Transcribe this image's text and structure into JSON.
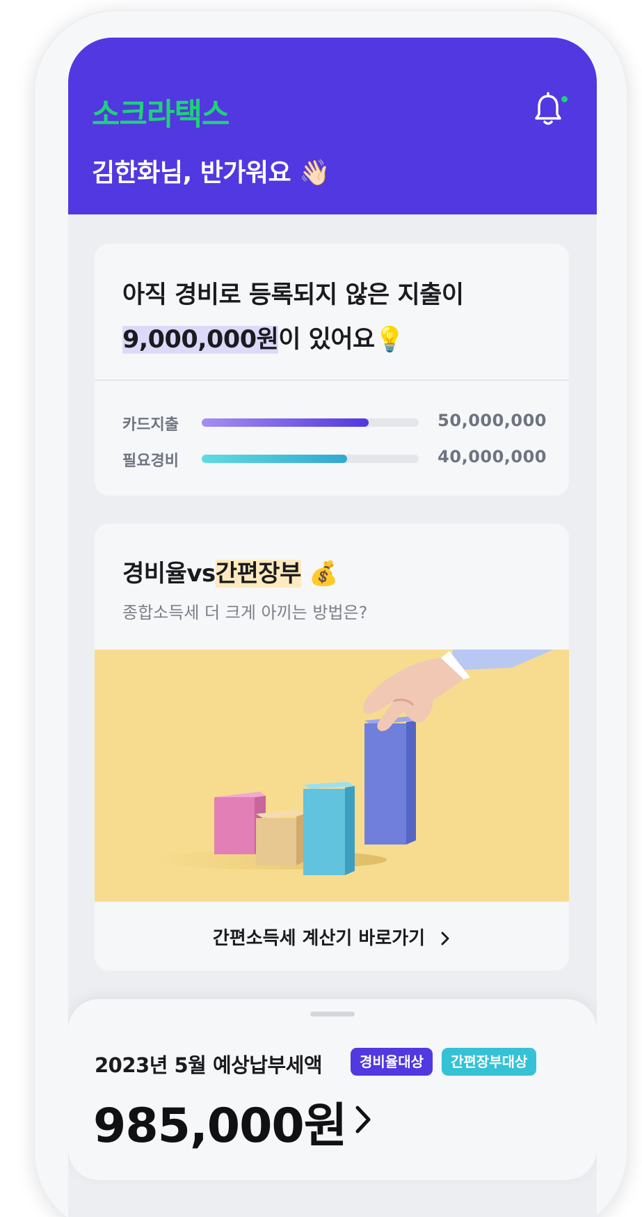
{
  "app": {
    "logo_text": "소크라택스",
    "brand_color": "#5138e0",
    "accent_color": "#1fd17b",
    "notification_icon": "bell-icon"
  },
  "header": {
    "greeting": "김한화님, 반가워요",
    "greeting_emoji": "👋🏻"
  },
  "expense_card": {
    "title_line1": "아직 경비로 등록되지 않은 지출이",
    "highlight_amount": "9,000,000원",
    "title_line2_rest": "이 있어요",
    "title_emoji": "💡",
    "rows": [
      {
        "label": "카드지출",
        "value": "50,000,000",
        "progress": 0.77
      },
      {
        "label": "필요경비",
        "value": "40,000,000",
        "progress": 0.67
      }
    ]
  },
  "promo_card": {
    "title_prefix": "경비율vs",
    "title_highlight": "간편장부",
    "title_emoji": "💰",
    "subtitle": "종합소득세 더 크게 아끼는 방법은?",
    "illustration": "hand-placing-bar-chart-blocks",
    "link_label": "간편소득세 계산기 바로가기"
  },
  "bottom_sheet": {
    "tax_label": "2023년 5월 예상납부세액",
    "badges": [
      "경비율대상",
      "간편장부대상"
    ],
    "amount": "985,000원"
  }
}
